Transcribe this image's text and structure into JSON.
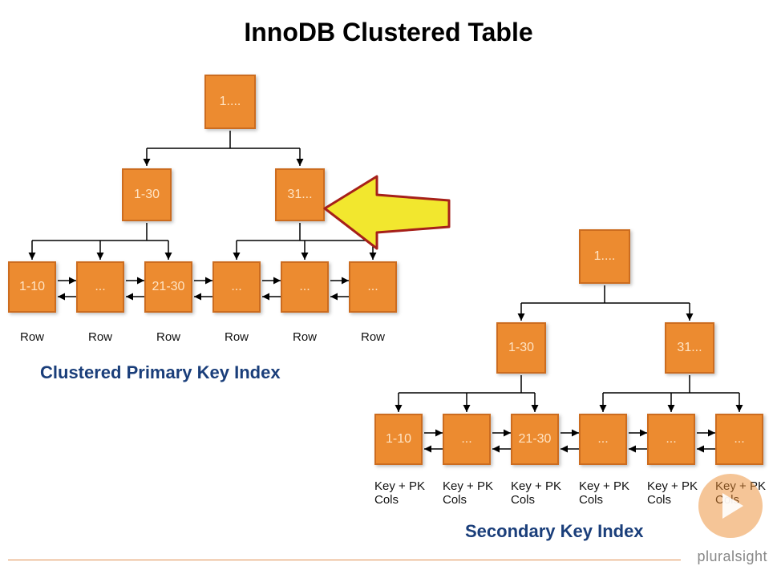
{
  "title": "InnoDB Clustered Table",
  "primary": {
    "subtitle": "Clustered Primary Key Index",
    "root": "1....",
    "mid": [
      "1-30",
      "31..."
    ],
    "leaves": [
      "1-10",
      "...",
      "21-30",
      "...",
      "...",
      "..."
    ],
    "leaf_labels": [
      "Row",
      "Row",
      "Row",
      "Row",
      "Row",
      "Row"
    ]
  },
  "secondary": {
    "subtitle": "Secondary Key Index",
    "root": "1....",
    "mid": [
      "1-30",
      "31..."
    ],
    "leaves": [
      "1-10",
      "...",
      "21-30",
      "...",
      "...",
      "..."
    ],
    "leaf_labels": [
      "Key + PK Cols",
      "Key + PK Cols",
      "Key + PK Cols",
      "Key + PK Cols",
      "Key + PK Cols",
      "Key + PK Cols"
    ]
  },
  "brand": "pluralsight"
}
